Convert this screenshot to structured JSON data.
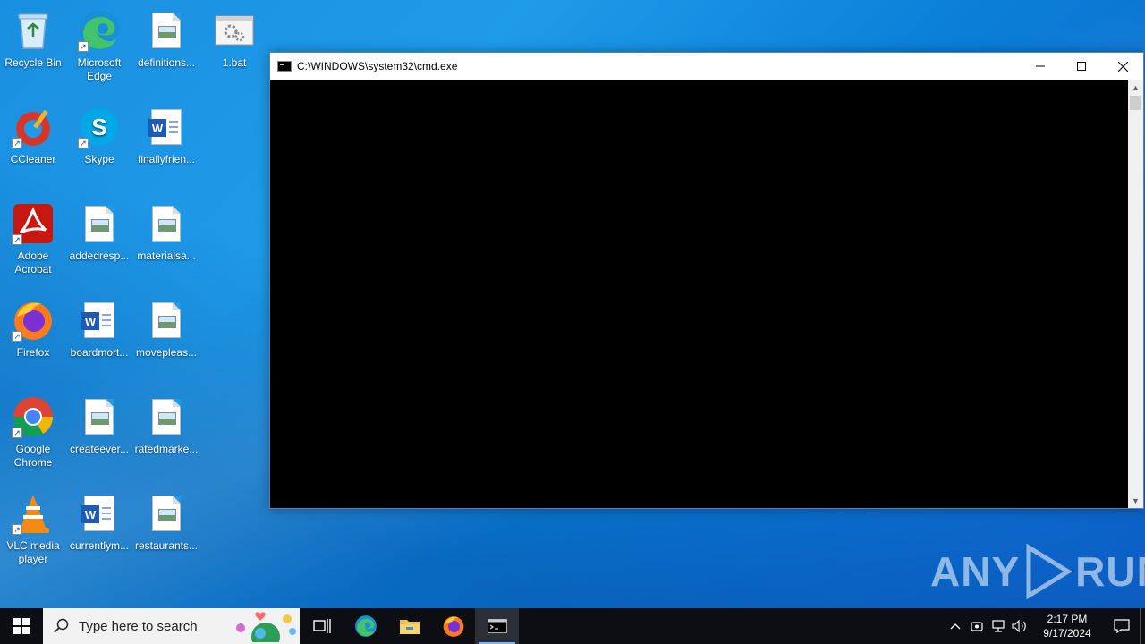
{
  "desktop": {
    "icons": [
      {
        "label": "Recycle Bin",
        "icon": "recycle-bin-icon"
      },
      {
        "label": "Microsoft Edge",
        "icon": "edge-icon"
      },
      {
        "label": "definitions...",
        "icon": "image-file-icon"
      },
      {
        "label": "1.bat",
        "icon": "batch-file-icon"
      },
      {
        "label": "CCleaner",
        "icon": "ccleaner-icon"
      },
      {
        "label": "Skype",
        "icon": "skype-icon"
      },
      {
        "label": "finallyfrien...",
        "icon": "word-doc-icon"
      },
      {
        "label": "Adobe Acrobat",
        "icon": "acrobat-icon"
      },
      {
        "label": "addedresp...",
        "icon": "image-file-icon"
      },
      {
        "label": "materialsa...",
        "icon": "image-file-icon"
      },
      {
        "label": "Firefox",
        "icon": "firefox-icon"
      },
      {
        "label": "boardmort...",
        "icon": "word-doc-icon"
      },
      {
        "label": "movepleas...",
        "icon": "image-file-icon"
      },
      {
        "label": "Google Chrome",
        "icon": "chrome-icon"
      },
      {
        "label": "createever...",
        "icon": "image-file-icon"
      },
      {
        "label": "ratedmarke...",
        "icon": "image-file-icon"
      },
      {
        "label": "VLC media player",
        "icon": "vlc-icon"
      },
      {
        "label": "currentlym...",
        "icon": "word-doc-icon"
      },
      {
        "label": "restaurants...",
        "icon": "image-file-icon"
      }
    ]
  },
  "window": {
    "title": "C:\\WINDOWS\\system32\\cmd.exe",
    "console_text": ""
  },
  "watermark": {
    "left": "ANY",
    "right": "RUN"
  },
  "taskbar": {
    "search_placeholder": "Type here to search",
    "apps": [
      "task-view-icon",
      "edge-icon",
      "file-explorer-icon",
      "firefox-icon",
      "cmd-icon"
    ],
    "clock_time": "2:17 PM",
    "clock_date": "9/17/2024"
  },
  "colors": {
    "desktop_blue": "#1e9be9",
    "taskbar": "#0c0e14",
    "console": "#000000"
  }
}
